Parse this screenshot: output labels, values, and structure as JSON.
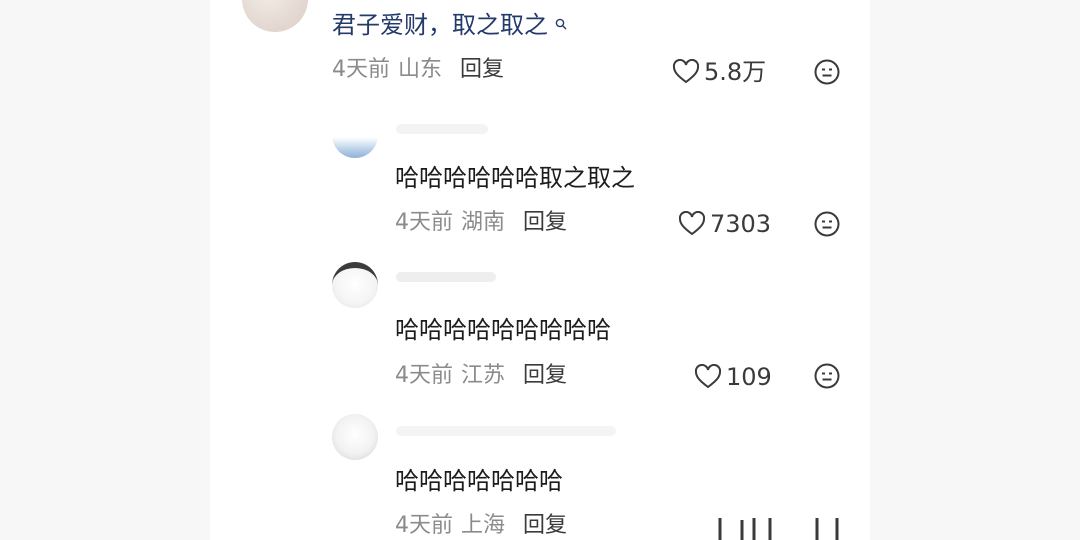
{
  "top_comment": {
    "text": "君子爱财，取之取之",
    "search_icon": "search-icon",
    "time": "4天前",
    "location": "山东",
    "reply_label": "回复",
    "likes": "5.8万"
  },
  "replies": [
    {
      "text": "哈哈哈哈哈哈取之取之",
      "time": "4天前",
      "location": "湖南",
      "reply_label": "回复",
      "likes": "7303"
    },
    {
      "text": "哈哈哈哈哈哈哈哈哈",
      "time": "4天前",
      "location": "江苏",
      "reply_label": "回复",
      "likes": "109"
    },
    {
      "text": "哈哈哈哈哈哈哈",
      "time": "4天前",
      "location": "上海",
      "reply_label": "回复",
      "likes": ""
    }
  ],
  "colors": {
    "link_blue": "#243a6b",
    "meta_gray": "#8b8b8b",
    "text_dark": "#1c1c1c"
  },
  "icons": {
    "like": "heart-outline-icon",
    "dislike": "neutral-face-icon"
  }
}
